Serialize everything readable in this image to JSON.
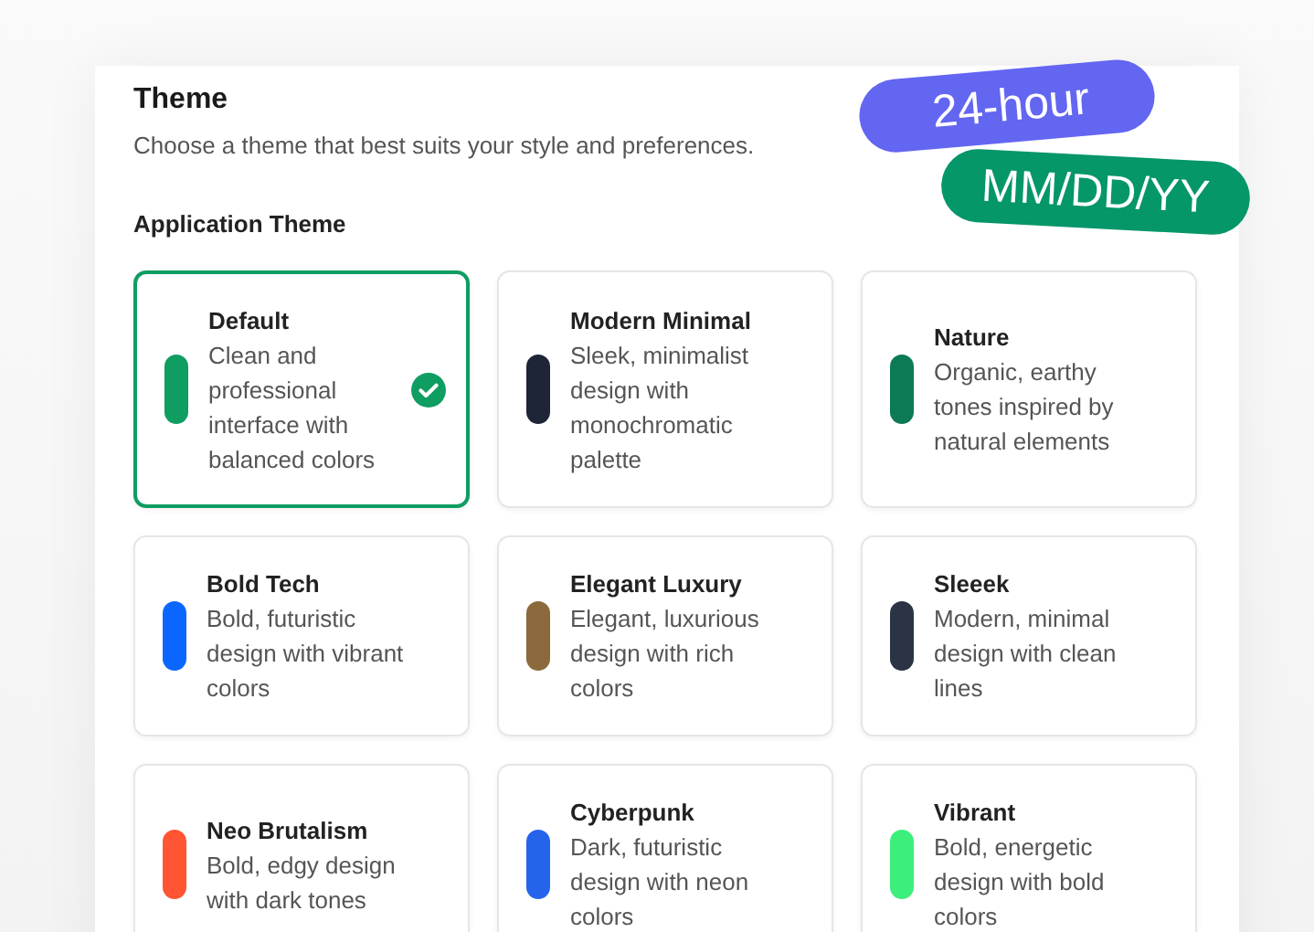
{
  "panel": {
    "title": "Theme",
    "description": "Choose a theme that best suits your style and preferences.",
    "section_label": "Application Theme"
  },
  "themes": [
    {
      "name": "Default",
      "description": "Clean and professional interface with balanced colors",
      "color": "#0f9d62",
      "selected": true
    },
    {
      "name": "Modern Minimal",
      "description": "Sleek, minimalist design with monochromatic palette",
      "color": "#1e2537",
      "selected": false
    },
    {
      "name": "Nature",
      "description": "Organic, earthy tones inspired by natural elements",
      "color": "#0b7a55",
      "selected": false
    },
    {
      "name": "Bold Tech",
      "description": "Bold, futuristic design with vibrant colors",
      "color": "#0a66ff",
      "selected": false
    },
    {
      "name": "Elegant Luxury",
      "description": "Elegant, luxurious design with rich colors",
      "color": "#8a6a3c",
      "selected": false
    },
    {
      "name": "Sleeek",
      "description": "Modern, minimal design with clean lines",
      "color": "#2a3444",
      "selected": false
    },
    {
      "name": "Neo Brutalism",
      "description": "Bold, edgy design with dark tones",
      "color": "#ff5533",
      "selected": false
    },
    {
      "name": "Cyberpunk",
      "description": "Dark, futuristic design with neon colors",
      "color": "#2563eb",
      "selected": false
    },
    {
      "name": "Vibrant",
      "description": "Bold, energetic design with bold colors",
      "color": "#3bef7a",
      "selected": false
    }
  ],
  "tags": [
    {
      "label": "24-hour",
      "color": "#6366f1"
    },
    {
      "label": "MM/DD/YY",
      "color": "#059669"
    }
  ]
}
